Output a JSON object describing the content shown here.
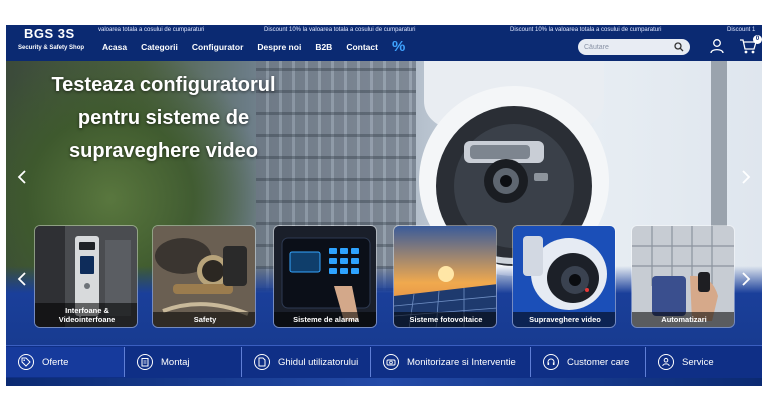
{
  "colors": {
    "header_bg": "#0b2a72",
    "accent": "#3fa3ff",
    "bar_bg": "#0f2f86"
  },
  "header": {
    "marquee": [
      "valoarea totala a cosului de cumparaturi",
      "Discount 10% la valoarea totala a cosului de cumparaturi",
      "Discount 10% la valoarea totala a cosului de cumparaturi",
      "Discount 1"
    ],
    "logo": {
      "main": "BGS 3S",
      "sub": "Security & Safety Shop"
    },
    "nav": [
      "Acasa",
      "Categorii",
      "Configurator",
      "Despre noi",
      "B2B",
      "Contact"
    ],
    "percent_icon": "%",
    "search": {
      "placeholder": "Căutare",
      "value": ""
    },
    "cart_count": "0"
  },
  "hero": {
    "title_lines": [
      "Testeaza configuratorul",
      "pentru sisteme de",
      "supraveghere video"
    ]
  },
  "categories": [
    {
      "label": "Interfoane & Videointerfoane",
      "icon": "intercom"
    },
    {
      "label": "Safety",
      "icon": "safety-gear"
    },
    {
      "label": "Sisteme de alarma",
      "icon": "alarm-keypad"
    },
    {
      "label": "Sisteme fotovoltaice",
      "icon": "solar-panels"
    },
    {
      "label": "Supraveghere video",
      "icon": "camera"
    },
    {
      "label": "Automatizari",
      "icon": "gate-remote"
    }
  ],
  "bottom_bar": [
    {
      "label": "Oferte",
      "icon": "tag-icon"
    },
    {
      "label": "Montaj",
      "icon": "clipboard-icon"
    },
    {
      "label": "Ghidul utilizatorului",
      "icon": "document-icon"
    },
    {
      "label": "Monitorizare si Interventie",
      "icon": "camera-icon"
    },
    {
      "label": "Customer care",
      "icon": "headset-icon"
    },
    {
      "label": "Service",
      "icon": "person-icon"
    }
  ]
}
